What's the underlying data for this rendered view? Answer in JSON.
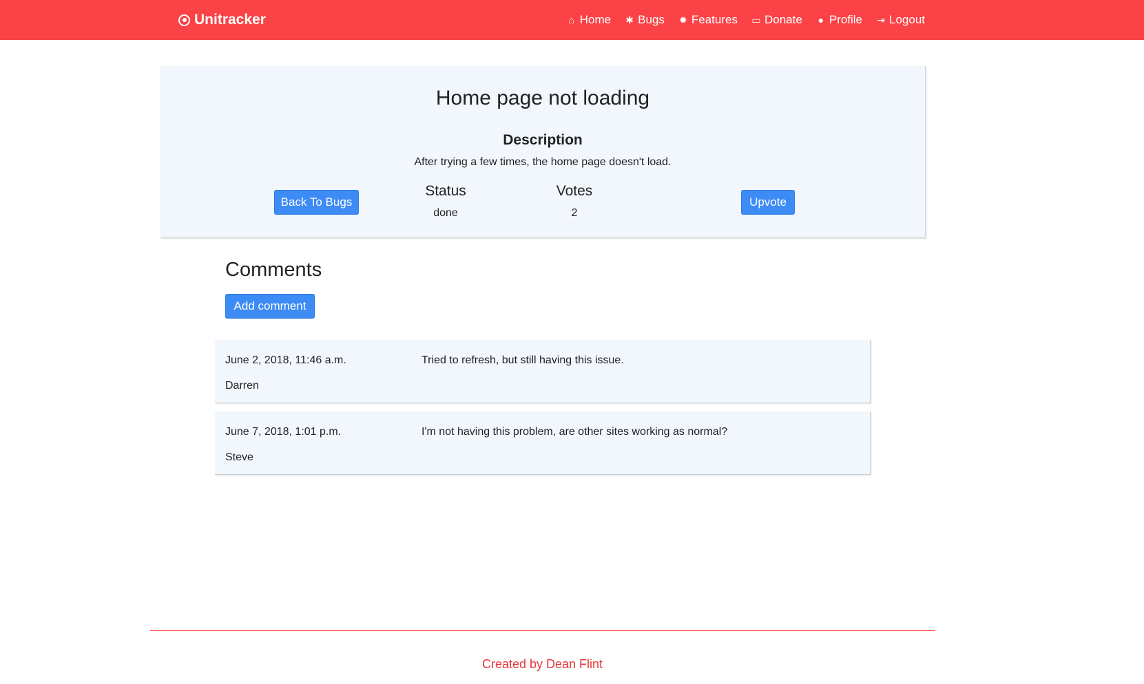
{
  "navbar": {
    "brand": "Unitracker",
    "brand_icon": "dot-circle-icon",
    "color": "#fb4246",
    "items": [
      {
        "label": "Home",
        "icon": "home-icon"
      },
      {
        "label": "Bugs",
        "icon": "bug-icon"
      },
      {
        "label": "Features",
        "icon": "certificate-icon"
      },
      {
        "label": "Donate",
        "icon": "credit-card-icon"
      },
      {
        "label": "Profile",
        "icon": "user-icon"
      },
      {
        "label": "Logout",
        "icon": "sign-out-icon"
      }
    ]
  },
  "bug": {
    "title": "Home page not loading",
    "description_heading": "Description",
    "description": "After trying a few times, the home page doesn't load.",
    "back_button": "Back To Bugs",
    "status_label": "Status",
    "status_value": "done",
    "votes_label": "Votes",
    "votes_value": "2",
    "upvote_button": "Upvote"
  },
  "comments": {
    "heading": "Comments",
    "add_button": "Add comment",
    "items": [
      {
        "date": "June 2, 2018, 11:46 a.m.",
        "author": "Darren",
        "text": "Tried to refresh, but still having this issue."
      },
      {
        "date": "June 7, 2018, 1:01 p.m.",
        "author": "Steve",
        "text": "I'm not having this problem, are other sites working as normal?"
      }
    ]
  },
  "footer": {
    "text": "Created by Dean Flint"
  },
  "colors": {
    "accent": "#fb4246",
    "button": "#3d8bf5",
    "panel": "#f1f7fd"
  }
}
